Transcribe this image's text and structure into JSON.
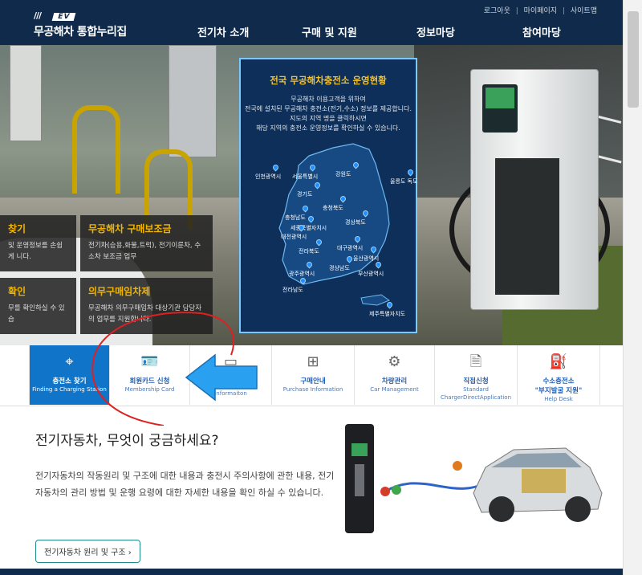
{
  "header": {
    "logo_badge": "EV",
    "logo_slashes": "///",
    "site_name": "무공해차 통합누리집",
    "util": [
      "로그아웃",
      "마이페이지",
      "사이트맵"
    ],
    "util_sep": "|",
    "nav": [
      "전기차 소개",
      "구매 및 지원",
      "정보마당",
      "참여마당"
    ]
  },
  "hero": {
    "info_boxes": [
      {
        "title": "찾기",
        "text": "및 운영정보를 손쉽게 니다."
      },
      {
        "title": "무공해차 구매보조금",
        "text": "전기차(승용,화물,트럭), 전기이륜차, 수소차 보조금 업무"
      },
      {
        "title": "확인",
        "text": "무를 확인하실 수 있습"
      },
      {
        "title": "의무구매임차제",
        "text": "무공해차 의무구매임차 대상기관 담당자의 업무를 지원합니다."
      }
    ]
  },
  "map": {
    "title": "전국 무공해차충전소 운영현황",
    "desc": [
      "무공해차 이용고객을 위하여",
      "전국에 설치된 무공해차 충전소(전기,수소) 정보를 제공합니다.",
      "지도의 지역 명을 클릭하시면",
      "해당 지역의 충전소 운영정보를 확인하실 수 있습니다."
    ],
    "regions": [
      "인천광역시",
      "서울특별시",
      "강원도",
      "울릉도 독도",
      "경기도",
      "충청북도",
      "충청남도",
      "세종특별자치시",
      "대전광역시",
      "경상북도",
      "전라북도",
      "대구광역시",
      "울산광역시",
      "광주광역시",
      "경상남도",
      "부산광역시",
      "전라남도",
      "제주특별자치도"
    ]
  },
  "quick_menu": [
    {
      "icon": "location-pin-icon",
      "label": "충전소 찾기",
      "sub": "Finding a Charging Station",
      "active": true
    },
    {
      "icon": "id-card-icon",
      "label": "회원카드 신청",
      "sub": "Membership Card",
      "active": false
    },
    {
      "icon": "card-icon",
      "label": "",
      "sub": "rger Support",
      "sub2": "Informaiton",
      "active": false
    },
    {
      "icon": "purchase-info-icon",
      "label": "구매안내",
      "sub": "Purchase Information",
      "active": false
    },
    {
      "icon": "car-manage-icon",
      "label": "차량관리",
      "sub": "Car Management",
      "active": false
    },
    {
      "icon": "document-icon",
      "label": "직접신청",
      "sub": "Standard",
      "sub2": "ChargerDirectApplication",
      "active": false
    },
    {
      "icon": "hydrogen-icon",
      "label": "수소충전소",
      "label2": "\"부지발굴 지원\"",
      "sub": "Help Desk",
      "active": false
    }
  ],
  "content": {
    "heading": "전기자동차, 무엇이 궁금하세요?",
    "paragraph": "전기자동차의 작동원리 및 구조에 대한 내용과 충전시 주의사항에 관한 내용, 전기자동차의 관리 방법 및 운행 요령에 대한 자세한 내용을 확인 하실 수 있습니다.",
    "button": "전기자동차 원리 및 구조 ›"
  },
  "colors": {
    "navy": "#0f2a4a",
    "accent_blue": "#1074c9",
    "gold": "#f1b500",
    "annotation_red": "#e02020",
    "annotation_arrow": "#2aa0f0"
  }
}
